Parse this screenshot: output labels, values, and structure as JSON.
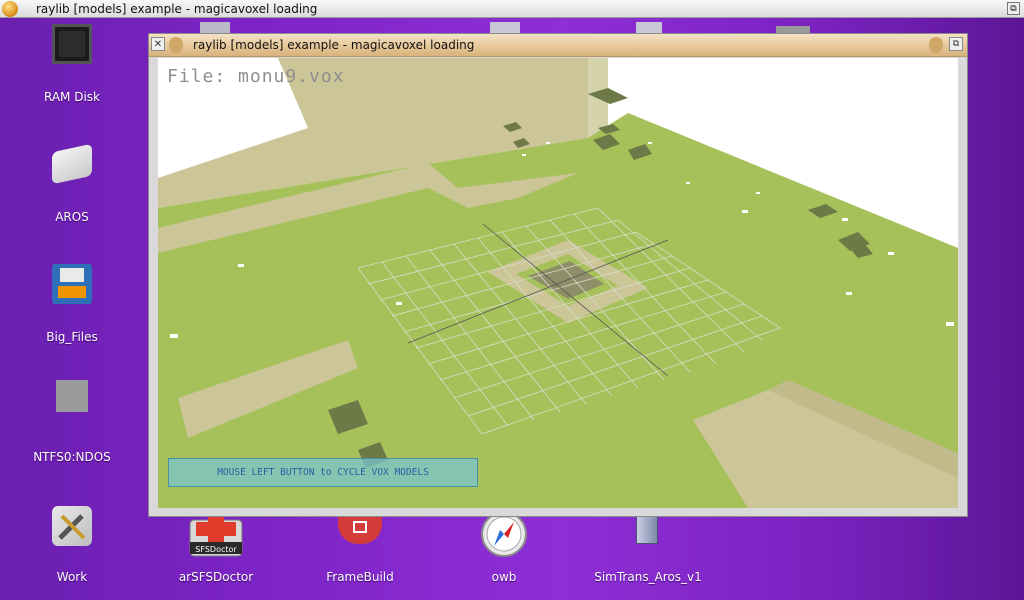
{
  "screen": {
    "title": "raylib [models] example - magicavoxel loading"
  },
  "desktop_icons": [
    {
      "label": "RAM Disk",
      "icon": "chip-icon"
    },
    {
      "label": "AROS",
      "icon": "drive-icon"
    },
    {
      "label": "Big_Files",
      "icon": "floppy-icon"
    },
    {
      "label": "NTFS0:NDOS",
      "icon": "volume-icon"
    },
    {
      "label": "Work",
      "icon": "tools-icon"
    },
    {
      "label": "arSFSDoctor",
      "icon": "sfsdoctor-icon"
    },
    {
      "label": "FrameBuild",
      "icon": "framebuild-icon"
    },
    {
      "label": "owb",
      "icon": "compass-icon"
    },
    {
      "label": "SimTrans_Aros_v1",
      "icon": "server-icon"
    }
  ],
  "window": {
    "title": "raylib [models] example - magicavoxel loading",
    "file_text": "File: monu9.vox",
    "info_text": "MOUSE LEFT BUTTON to CYCLE VOX MODELS"
  },
  "colors": {
    "desktop": "#7d24c6",
    "ground": "#a6c15a",
    "path": "#cbc598",
    "info_box": "#78c4cd"
  }
}
